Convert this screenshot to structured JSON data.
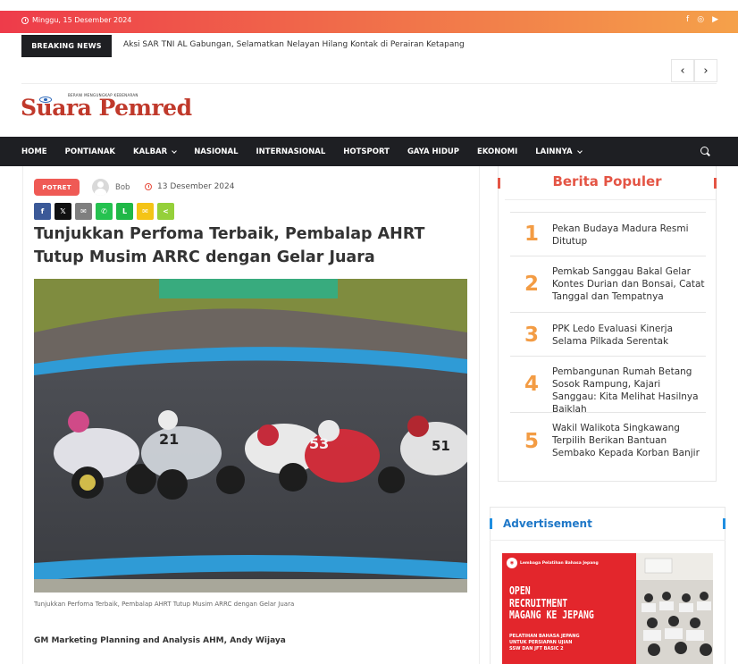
{
  "topbar": {
    "date": "Minggu, 15 Desember 2024",
    "social_icons": [
      "facebook-icon",
      "instagram-icon",
      "youtube-icon"
    ]
  },
  "breaking": {
    "label": "BREAKING NEWS",
    "headline": "Aksi SAR TNI AL Gabungan, Selamatkan Nelayan Hilang Kontak di Perairan Ketapang"
  },
  "brand": {
    "tagline": "BERANI MENGUNGKAP KEBENARAN",
    "name": "Suara Pemred",
    "color": "#c0392b"
  },
  "nav": {
    "items": [
      {
        "label": "HOME",
        "dropdown": false
      },
      {
        "label": "PONTIANAK",
        "dropdown": false
      },
      {
        "label": "KALBAR",
        "dropdown": true
      },
      {
        "label": "NASIONAL",
        "dropdown": false
      },
      {
        "label": "INTERNASIONAL",
        "dropdown": false
      },
      {
        "label": "HOTSPORT",
        "dropdown": false
      },
      {
        "label": "GAYA HIDUP",
        "dropdown": false
      },
      {
        "label": "EKONOMI",
        "dropdown": false
      },
      {
        "label": "LAINNYA",
        "dropdown": true
      }
    ]
  },
  "article": {
    "category": "POTRET",
    "author": "Bob",
    "date": "13 Desember 2024",
    "title": "Tunjukkan Perfoma Terbaik, Pembalap AHRT Tutup Musim ARRC dengan Gelar Juara",
    "caption": "Tunjukkan Perfoma Terbaik, Pembalap AHRT Tutup Musim ARRC dengan Gelar Juara",
    "subhead": "GM Marketing Planning and Analysis AHM, Andy Wijaya",
    "share_buttons": [
      {
        "name": "facebook",
        "glyph": "f",
        "color": "#3b5998"
      },
      {
        "name": "x",
        "glyph": "𝕏",
        "color": "#111111"
      },
      {
        "name": "email",
        "glyph": "✉",
        "color": "#7f7f7f"
      },
      {
        "name": "whatsapp",
        "glyph": "✆",
        "color": "#25c250"
      },
      {
        "name": "line",
        "glyph": "L",
        "color": "#20b847"
      },
      {
        "name": "sms",
        "glyph": "✉",
        "color": "#f4c416"
      },
      {
        "name": "sharethis",
        "glyph": "<",
        "color": "#95d03a"
      }
    ]
  },
  "popular": {
    "title": "Berita Populer",
    "items": [
      {
        "rank": "1",
        "text": "Pekan Budaya Madura Resmi Ditutup"
      },
      {
        "rank": "2",
        "text": "Pemkab Sanggau Bakal Gelar Kontes Durian dan Bonsai, Catat Tanggal dan Tempatnya"
      },
      {
        "rank": "3",
        "text": "PPK Ledo Evaluasi Kinerja Selama Pilkada Serentak"
      },
      {
        "rank": "4",
        "text": "Pembangunan Rumah Betang Sosok Rampung, Kajari Sanggau: Kita Melihat Hasilnya Baiklah"
      },
      {
        "rank": "5",
        "text": "Wakil Walikota Singkawang Terpilih Berikan Bantuan Sembako Kepada Korban Banjir"
      }
    ]
  },
  "advertisement": {
    "title": "Advertisement",
    "org": "Lembaga Pelatihan Bahasa Jepang",
    "headline_1": "OPEN",
    "headline_2": "RECRUITMENT",
    "headline_3": "MAGANG KE JEPANG",
    "sub_1": "PELATIHAN BAHASA JEPANG",
    "sub_2": "UNTUK PERSIAPAN UJIAN",
    "sub_3": "SSW DAN JFT BASIC 2"
  }
}
